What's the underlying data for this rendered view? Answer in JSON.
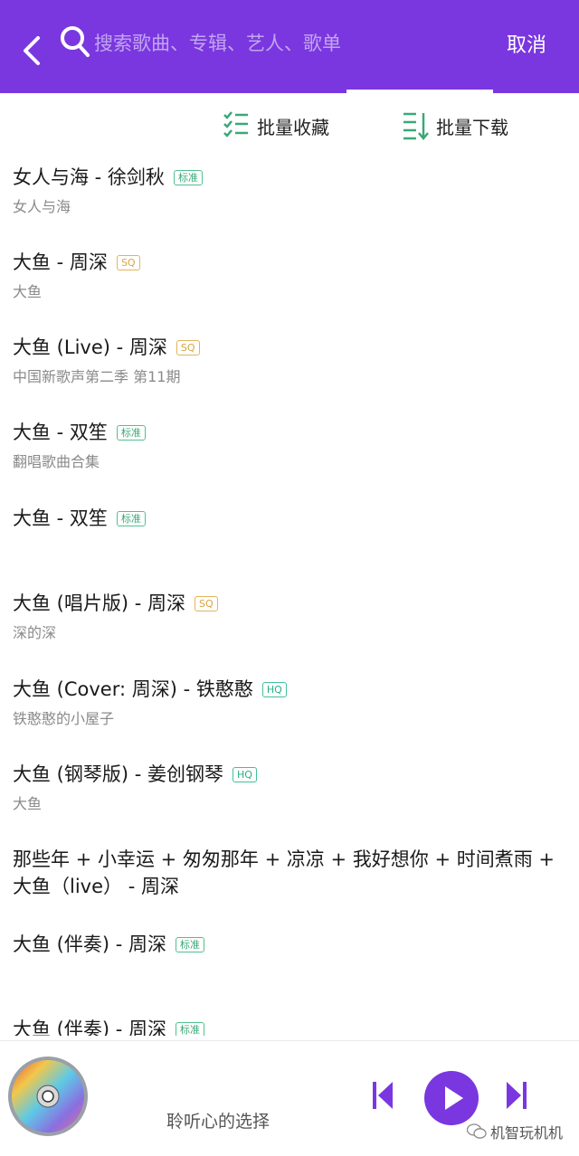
{
  "header": {
    "search_placeholder": "搜索歌曲、专辑、艺人、歌单",
    "cancel_label": "取消"
  },
  "actions": {
    "batch_collect": "批量收藏",
    "batch_download": "批量下载"
  },
  "songs": [
    {
      "title": "女人与海 - 徐剑秋",
      "quality": "标准",
      "album": "女人与海"
    },
    {
      "title": "大鱼 - 周深",
      "quality": "SQ",
      "album": "大鱼"
    },
    {
      "title": "大鱼 (Live) - 周深",
      "quality": "SQ",
      "album": "中国新歌声第二季 第11期"
    },
    {
      "title": "大鱼 - 双笙",
      "quality": "标准",
      "album": "翻唱歌曲合集"
    },
    {
      "title": "大鱼 - 双笙",
      "quality": "标准",
      "album": ""
    },
    {
      "title": "大鱼 (唱片版) - 周深",
      "quality": "SQ",
      "album": "深的深"
    },
    {
      "title": "大鱼 (Cover: 周深) - 铁憨憨",
      "quality": "HQ",
      "album": "铁憨憨的小屋子"
    },
    {
      "title": "大鱼 (钢琴版) - 姜创钢琴",
      "quality": "HQ",
      "album": "大鱼"
    },
    {
      "title": "那些年 + 小幸运 + 匆匆那年 + 凉凉 + 我好想你 + 时间煮雨 + 大鱼（live） - 周深",
      "quality": "",
      "album": ""
    },
    {
      "title": "大鱼 (伴奏) - 周深",
      "quality": "标准",
      "album": ""
    },
    {
      "title": "大鱼 (伴奏) - 周深",
      "quality": "标准",
      "album": ""
    }
  ],
  "player": {
    "now_playing_text": "聆听心的选择",
    "watermark": "机智玩机机"
  },
  "colors": {
    "accent": "#7a37df",
    "standard_badge": "#3aa877",
    "sq_badge": "#d7a442",
    "hq_badge": "#2aae86"
  },
  "icons": {
    "back": "back-arrow-icon",
    "search": "search-icon",
    "collect": "checklist-icon",
    "download": "download-list-icon",
    "prev": "skip-previous-icon",
    "play": "play-icon",
    "next": "skip-next-icon",
    "disc": "cd-disc-icon"
  }
}
